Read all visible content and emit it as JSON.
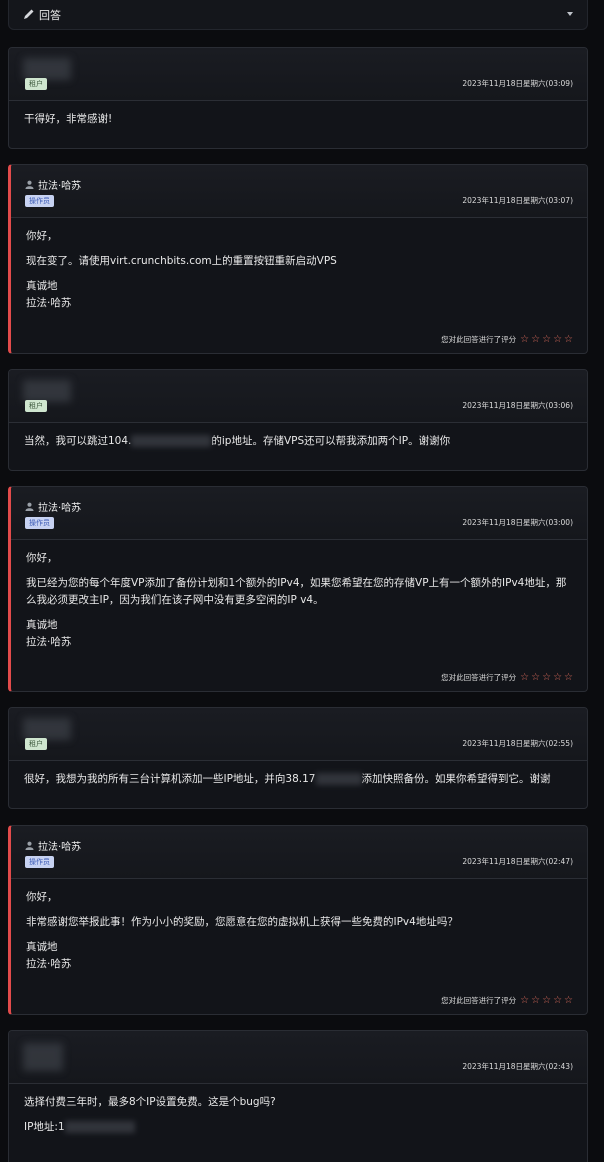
{
  "reply_bar": {
    "label": "回答"
  },
  "rating_prompt": "您对此回答进行了评分",
  "messages": [
    {
      "type": "user",
      "role": "租户",
      "date": "2023年11月18日星期六(03:09)",
      "lines": [
        "干得好，非常感谢!"
      ]
    },
    {
      "type": "staff",
      "name": "拉法·哈苏",
      "role": "操作员",
      "date": "2023年11月18日星期六(03:07)",
      "lines": [
        "你好，",
        "现在变了。请使用virt.crunchbits.com上的重置按钮重新启动VPS",
        "真诚地",
        "拉法·哈苏"
      ]
    },
    {
      "type": "user",
      "role": "租户",
      "date": "2023年11月18日星期六(03:06)",
      "line_a": "当然，我可以跳过104.",
      "line_b": "的ip地址。存储VPS还可以帮我添加两个IP。谢谢你"
    },
    {
      "type": "staff",
      "name": "拉法·哈苏",
      "role": "操作员",
      "date": "2023年11月18日星期六(03:00)",
      "lines": [
        "你好，",
        "我已经为您的每个年度VP添加了备份计划和1个额外的IPv4，如果您希望在您的存储VP上有一个额外的IPv4地址，那么我必须更改主IP，因为我们在该子网中没有更多空闲的IP v4。",
        "真诚地",
        "拉法·哈苏"
      ]
    },
    {
      "type": "user",
      "role": "租户",
      "date": "2023年11月18日星期六(02:55)",
      "line_a": "很好，我想为我的所有三台计算机添加一些IP地址，并向38.17",
      "line_b": "添加快照备份。如果你希望得到它。谢谢"
    },
    {
      "type": "staff",
      "name": "拉法·哈苏",
      "role": "操作员",
      "date": "2023年11月18日星期六(02:47)",
      "lines": [
        "你好，",
        "非常感谢您举报此事！作为小小的奖励，您愿意在您的虚拟机上获得一些免费的IPv4地址吗？",
        "真诚地",
        "拉法·哈苏"
      ]
    },
    {
      "type": "user",
      "role": "",
      "date": "2023年11月18日星期六(02:43)",
      "line_a": "选择付费三年时，最多8个IP设置免费。这是个bug吗?",
      "line_b": "IP地址:1"
    }
  ]
}
